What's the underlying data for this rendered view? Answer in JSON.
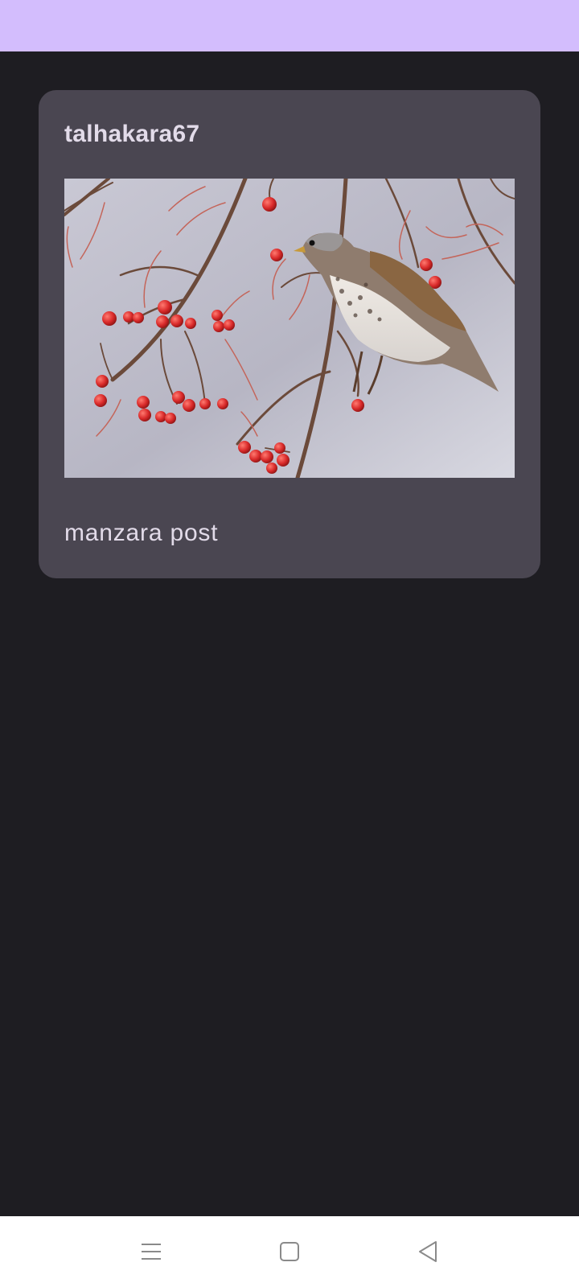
{
  "colors": {
    "top_bar": "#d3bdfd",
    "background": "#1e1d22",
    "card": "#4a4651",
    "card_text": "#e2dbe9",
    "nav_bar": "#ffffff",
    "nav_icon": "#8a8a8a"
  },
  "post": {
    "username": "talhakara67",
    "image": "bird-eating-red-berries-on-branches",
    "caption": "manzara post"
  },
  "nav": {
    "menu_icon": "menu-icon",
    "home_icon": "square-home-icon",
    "back_icon": "triangle-back-icon"
  }
}
